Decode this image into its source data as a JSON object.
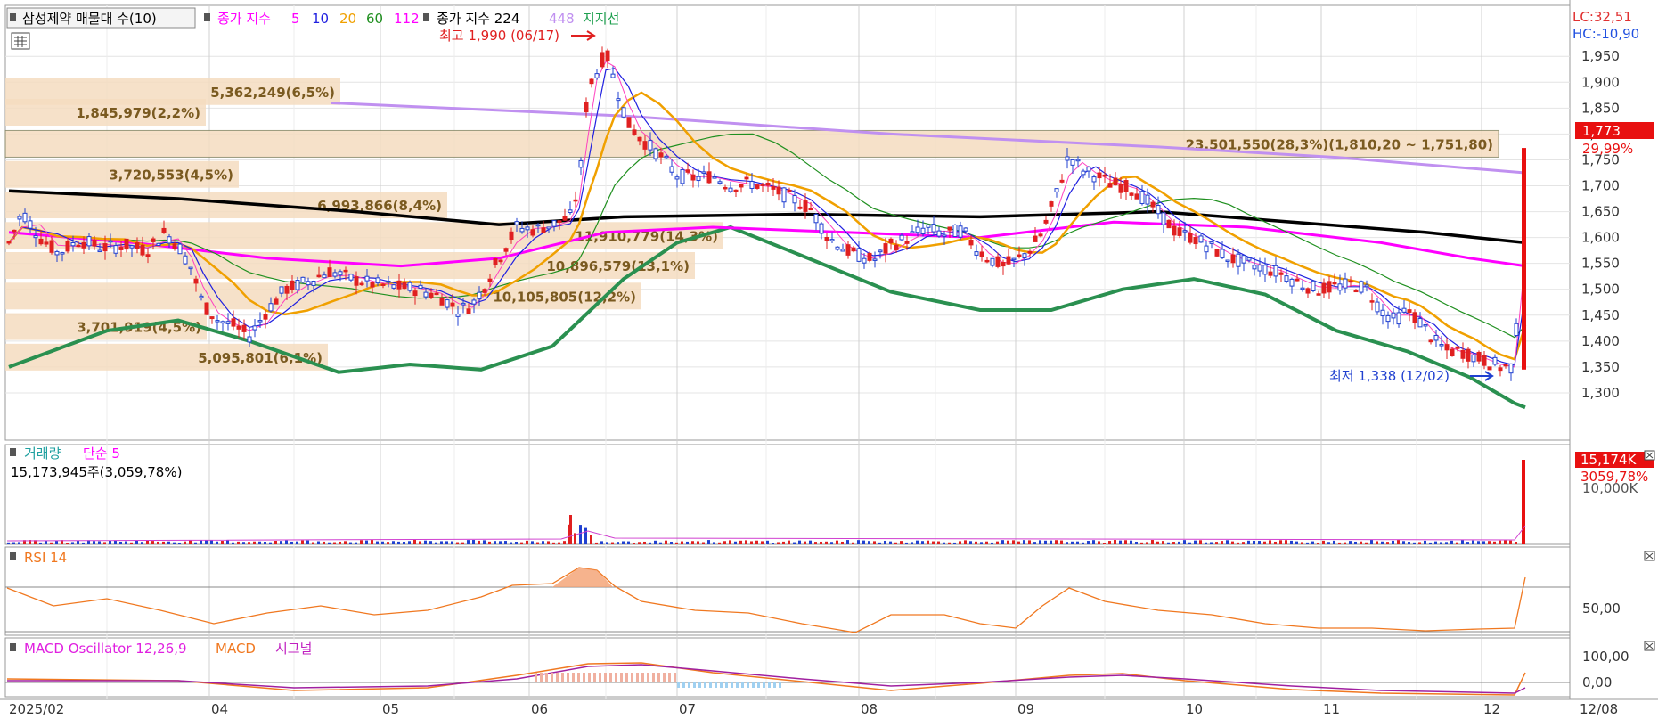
{
  "title_box": "삼성제약 매물대 수(10)",
  "ma_legend": {
    "prefix": "종가 지수",
    "periods": [
      {
        "label": "5",
        "color": "#ff00ff"
      },
      {
        "label": "10",
        "color": "#2020e0"
      },
      {
        "label": "20",
        "color": "#f0a000"
      },
      {
        "label": "60",
        "color": "#209020"
      },
      {
        "label": "112",
        "color": "#ff00ff"
      }
    ],
    "long": {
      "label": "종가 지수 224",
      "color": "#000000"
    },
    "p448": {
      "label": "448",
      "color": "#c090f0"
    },
    "support": {
      "label": "지지선",
      "color": "#20a050"
    }
  },
  "lc_hc": {
    "lc": "LC:32,51",
    "hc": "HC:-10,90"
  },
  "price_axis": [
    "1,950",
    "1,900",
    "1,850",
    "1,800",
    "1,750",
    "1,700",
    "1,650",
    "1,600",
    "1,550",
    "1,500",
    "1,450",
    "1,400",
    "1,350",
    "1,300"
  ],
  "current": {
    "price": "1,773",
    "pct": "29,99%"
  },
  "high_marker": "최고 1,990 (06/17)",
  "low_marker": "최저 1,338 (12/02)",
  "volume_profile": [
    {
      "label": "5,362,249(6,5%)",
      "price": 1882
    },
    {
      "label": "1,845,979(2,2%)",
      "price": 1842
    },
    {
      "label": "23,501,550(28,3%)(1,810,20 ~ 1,751,80)",
      "price": 1781,
      "highlight": true
    },
    {
      "label": "3,720,553(4,5%)",
      "price": 1722
    },
    {
      "label": "6,993,866(8,4%)",
      "price": 1663
    },
    {
      "label": "11,910,779(14,3%)",
      "price": 1604
    },
    {
      "label": "10,896,579(13,1%)",
      "price": 1546
    },
    {
      "label": "10,105,805(12,2%)",
      "price": 1487
    },
    {
      "label": "3,701,919(4,5%)",
      "price": 1428
    },
    {
      "label": "5,095,801(6,1%)",
      "price": 1369
    }
  ],
  "volume_panel": {
    "title": "거래량",
    "ma": "단순 5",
    "value": "15,173,945주(3,059,78%)",
    "axis": "10,000K",
    "current": "15,174K",
    "current_pct": "3059,78%"
  },
  "rsi_panel": {
    "title": "RSI 14",
    "axis": "50,00"
  },
  "macd_panel": {
    "title": "MACD Oscillator 12,26,9",
    "macd": "MACD",
    "signal": "시그널",
    "axis": [
      "100,00",
      "0,00"
    ]
  },
  "x_axis": [
    "2025/02",
    "04",
    "05",
    "06",
    "07",
    "08",
    "09",
    "10",
    "11",
    "12"
  ],
  "x_axis_end": "12/08",
  "chart_data": {
    "type": "candlestick",
    "x_range": [
      "2025/02",
      "12/08"
    ],
    "ylim": [
      1250,
      1990
    ],
    "high": {
      "value": 1990,
      "date": "06/17"
    },
    "low": {
      "value": 1338,
      "date": "12/02"
    },
    "last_close": 1773,
    "key_closes": [
      {
        "date": "2025/02",
        "close": 1590
      },
      {
        "date": "04",
        "close": 1430
      },
      {
        "date": "05",
        "close": 1505
      },
      {
        "date": "05 end",
        "close": 1460
      },
      {
        "date": "06 mid",
        "close": 1960
      },
      {
        "date": "07",
        "close": 1710
      },
      {
        "date": "08",
        "close": 1570
      },
      {
        "date": "08 end",
        "close": 1530
      },
      {
        "date": "09 mid",
        "close": 1760
      },
      {
        "date": "10",
        "close": 1600
      },
      {
        "date": "11",
        "close": 1510
      },
      {
        "date": "12/02",
        "close": 1350
      },
      {
        "date": "12/08",
        "close": 1773
      }
    ],
    "ma224_end": 1590,
    "ma448_start": 1860,
    "ma448_end": 1725,
    "support_min": 1272,
    "volume_last": 15173945,
    "rsi_reference": 50,
    "macd_reference": 0
  }
}
